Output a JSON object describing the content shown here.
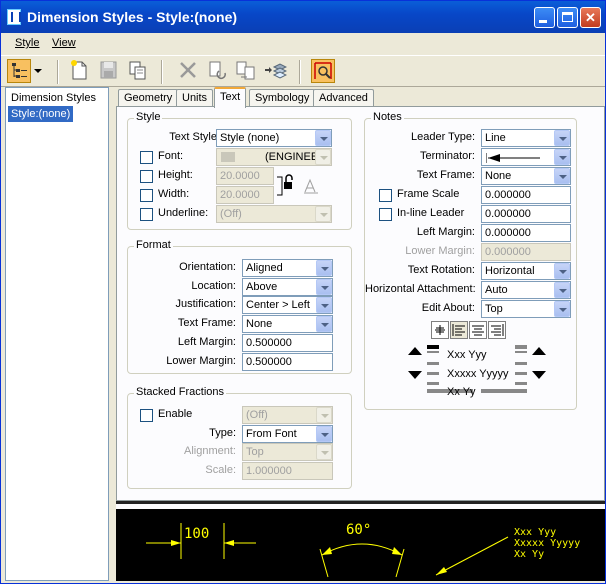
{
  "window": {
    "title": "Dimension Styles -  Style:(none)"
  },
  "menubar": {
    "items": [
      {
        "label": "Style"
      },
      {
        "label": "View"
      }
    ]
  },
  "tree": {
    "items": [
      {
        "label": "Dimension Styles"
      },
      {
        "label": "Style:(none)"
      }
    ]
  },
  "tabs": [
    {
      "label": "Geometry"
    },
    {
      "label": "Units"
    },
    {
      "label": "Text"
    },
    {
      "label": "Symbology"
    },
    {
      "label": "Advanced"
    }
  ],
  "style": {
    "title": "Style",
    "text_style_label": "Text Style:",
    "text_style_value": "Style (none)",
    "font_label": "Font:",
    "font_value": "(ENGINEE",
    "height_label": "Height:",
    "height_value": "20.0000",
    "width_label": "Width:",
    "width_value": "20.0000",
    "underline_label": "Underline:",
    "underline_value": "(Off)"
  },
  "format": {
    "title": "Format",
    "orientation_label": "Orientation:",
    "orientation_value": "Aligned",
    "location_label": "Location:",
    "location_value": "Above",
    "justification_label": "Justification:",
    "justification_value": "Center > Left",
    "text_frame_label": "Text Frame:",
    "text_frame_value": "None",
    "left_margin_label": "Left Margin:",
    "left_margin_value": "0.500000",
    "lower_margin_label": "Lower Margin:",
    "lower_margin_value": "0.500000"
  },
  "stacked": {
    "title": "Stacked Fractions",
    "enable_label": "Enable",
    "enable_value": "(Off)",
    "type_label": "Type:",
    "type_value": "From Font",
    "alignment_label": "Alignment:",
    "alignment_value": "Top",
    "scale_label": "Scale:",
    "scale_value": "1.000000"
  },
  "notes": {
    "title": "Notes",
    "leader_type_label": "Leader Type:",
    "leader_type_value": "Line",
    "terminator_label": "Terminator:",
    "text_frame_label": "Text Frame:",
    "text_frame_value": "None",
    "frame_scale_label": "Frame Scale",
    "frame_scale_value": "0.000000",
    "inline_leader_label": "In-line Leader",
    "inline_leader_value": "0.000000",
    "left_margin_label": "Left Margin:",
    "left_margin_value": "0.000000",
    "lower_margin_label": "Lower Margin:",
    "lower_margin_value": "0.000000",
    "text_rotation_label": "Text Rotation:",
    "text_rotation_value": "Horizontal",
    "horizontal_attachment_label": "Horizontal Attachment:",
    "horizontal_attachment_value": "Auto",
    "edit_about_label": "Edit About:",
    "edit_about_value": "Top",
    "preview_line1": "Xxx Yyy",
    "preview_line2": "Xxxxx Yyyyy",
    "preview_line3": "Xx Yy"
  },
  "preview": {
    "linear_value": "100",
    "angular_value": "60°",
    "note_line1": "Xxx Yyy",
    "note_line2": "Xxxxx Yyyyy",
    "note_line3": "Xx Yy"
  },
  "colors": {
    "title_bar": "#0a4fd0",
    "selection": "#316ac5",
    "active_tab": "#f1a838",
    "preview_bg": "#000000",
    "preview_fg": "#ffff00"
  }
}
